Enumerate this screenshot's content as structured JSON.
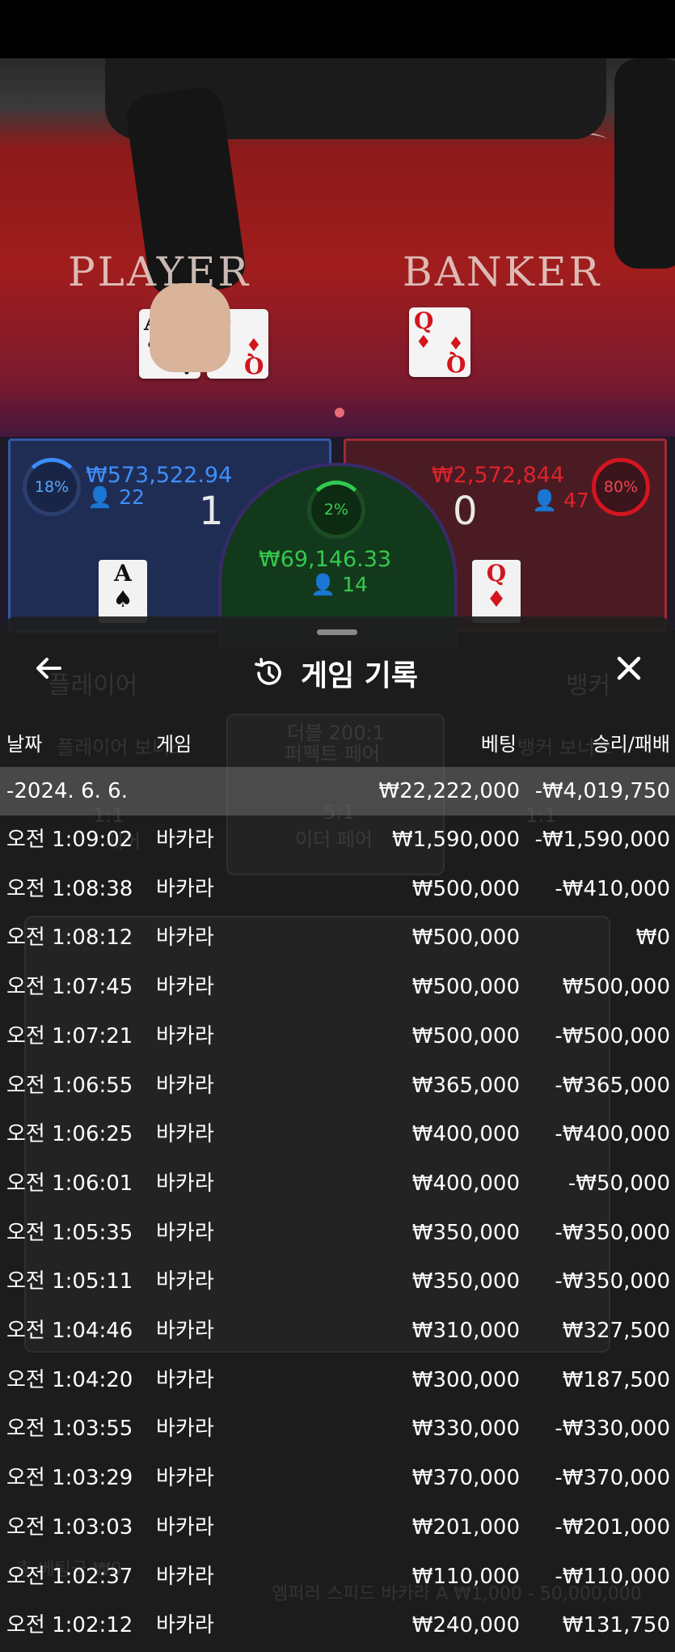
{
  "table": {
    "player_label": "PLAYER",
    "banker_label": "BANKER",
    "cards": {
      "player": [
        {
          "rank": "A",
          "suit": "♠",
          "color": "black"
        },
        {
          "rank": "Q",
          "suit": "♦",
          "color": "red"
        }
      ],
      "banker": [
        {
          "rank": "Q",
          "suit": "♦",
          "color": "red"
        }
      ]
    }
  },
  "bets": {
    "player": {
      "percent": "18%",
      "amount": "₩573,522.94",
      "count": "22",
      "score": "1",
      "card_rank": "A",
      "card_suit": "♠"
    },
    "tie": {
      "percent": "2%",
      "amount": "₩69,146.33",
      "count": "14"
    },
    "banker": {
      "percent": "80%",
      "amount": "₩2,572,844",
      "count": "47",
      "score": "0",
      "card_rank": "Q",
      "card_suit": "♦"
    }
  },
  "background_ui": {
    "tab_player": "플레이어",
    "tab_banker": "뱅커",
    "player_bonus": "플레이어 보너스",
    "banker_bonus": "뱅커 보너스",
    "perfect_pair": "퍼펙트 페어",
    "double_pair": "더블 200:1",
    "either_pair": "이더 페어",
    "either_odds": "5:1",
    "odds_left": "1:1",
    "odds_right": "1:1",
    "pair_label": "페어",
    "footer_balance": "총 베팅금 ₩0",
    "footer_table": "엠퍼러 스피드 바카라 A ₩1,000 - 50,000,000"
  },
  "sheet": {
    "title": "게임 기록",
    "columns": {
      "date": "날짜",
      "game": "게임",
      "bet": "베팅",
      "result": "승리/패배"
    },
    "summary": {
      "date": "-2024. 6. 6.",
      "bet": "₩22,222,000",
      "result": "-₩4,019,750"
    },
    "rows": [
      {
        "time": "오전 1:09:02",
        "game": "바카라",
        "bet": "₩1,590,000",
        "result": "-₩1,590,000"
      },
      {
        "time": "오전 1:08:38",
        "game": "바카라",
        "bet": "₩500,000",
        "result": "-₩410,000"
      },
      {
        "time": "오전 1:08:12",
        "game": "바카라",
        "bet": "₩500,000",
        "result": "₩0"
      },
      {
        "time": "오전 1:07:45",
        "game": "바카라",
        "bet": "₩500,000",
        "result": "₩500,000"
      },
      {
        "time": "오전 1:07:21",
        "game": "바카라",
        "bet": "₩500,000",
        "result": "-₩500,000"
      },
      {
        "time": "오전 1:06:55",
        "game": "바카라",
        "bet": "₩365,000",
        "result": "-₩365,000"
      },
      {
        "time": "오전 1:06:25",
        "game": "바카라",
        "bet": "₩400,000",
        "result": "-₩400,000"
      },
      {
        "time": "오전 1:06:01",
        "game": "바카라",
        "bet": "₩400,000",
        "result": "-₩50,000"
      },
      {
        "time": "오전 1:05:35",
        "game": "바카라",
        "bet": "₩350,000",
        "result": "-₩350,000"
      },
      {
        "time": "오전 1:05:11",
        "game": "바카라",
        "bet": "₩350,000",
        "result": "-₩350,000"
      },
      {
        "time": "오전 1:04:46",
        "game": "바카라",
        "bet": "₩310,000",
        "result": "₩327,500"
      },
      {
        "time": "오전 1:04:20",
        "game": "바카라",
        "bet": "₩300,000",
        "result": "₩187,500"
      },
      {
        "time": "오전 1:03:55",
        "game": "바카라",
        "bet": "₩330,000",
        "result": "-₩330,000"
      },
      {
        "time": "오전 1:03:29",
        "game": "바카라",
        "bet": "₩370,000",
        "result": "-₩370,000"
      },
      {
        "time": "오전 1:03:03",
        "game": "바카라",
        "bet": "₩201,000",
        "result": "-₩201,000"
      },
      {
        "time": "오전 1:02:37",
        "game": "바카라",
        "bet": "₩110,000",
        "result": "-₩110,000"
      },
      {
        "time": "오전 1:02:12",
        "game": "바카라",
        "bet": "₩240,000",
        "result": "₩131,750"
      }
    ]
  }
}
